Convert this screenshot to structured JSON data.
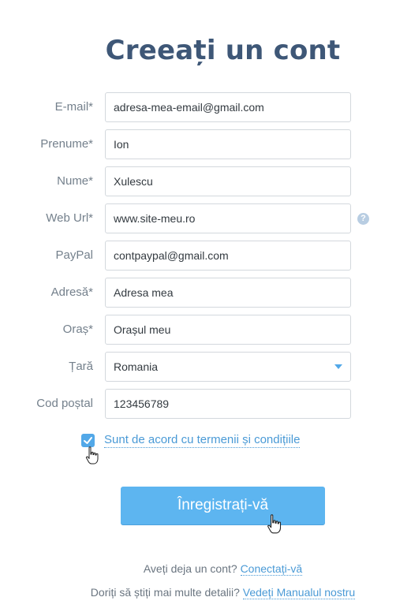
{
  "form": {
    "title": "Creeați un cont",
    "fields": [
      {
        "label": "E-mail*",
        "value": "adresa-mea-email@gmail.com"
      },
      {
        "label": "Prenume*",
        "value": "Ion"
      },
      {
        "label": "Nume*",
        "value": "Xulescu"
      },
      {
        "label": "Web Url*",
        "value": "www.site-meu.ro"
      },
      {
        "label": "PayPal",
        "value": "contpaypal@gmail.com"
      },
      {
        "label": "Adresă*",
        "value": "Adresa mea"
      },
      {
        "label": "Oraș*",
        "value": "Orașul meu"
      },
      {
        "label": "Țară",
        "value": "Romania"
      },
      {
        "label": "Cod poștal",
        "value": "123456789"
      }
    ],
    "help_icon": "?",
    "terms_checked": true,
    "terms_label": "Sunt de acord cu termenii și condițiile",
    "submit_label": "Înregistrați-vă"
  },
  "footer": {
    "login_prompt": "Aveți deja un cont?",
    "login_link": "Conectați-vă",
    "manual_prompt": "Doriți să știți mai multe detalii?",
    "manual_link": "Vedeți Manualul nostru"
  },
  "colors": {
    "accent": "#52a8e8",
    "title": "#3e5777",
    "button": "#5db5f0"
  },
  "icons": [
    "question-icon",
    "checkmark-icon",
    "chevron-down-icon",
    "hand-cursor-icon"
  ]
}
